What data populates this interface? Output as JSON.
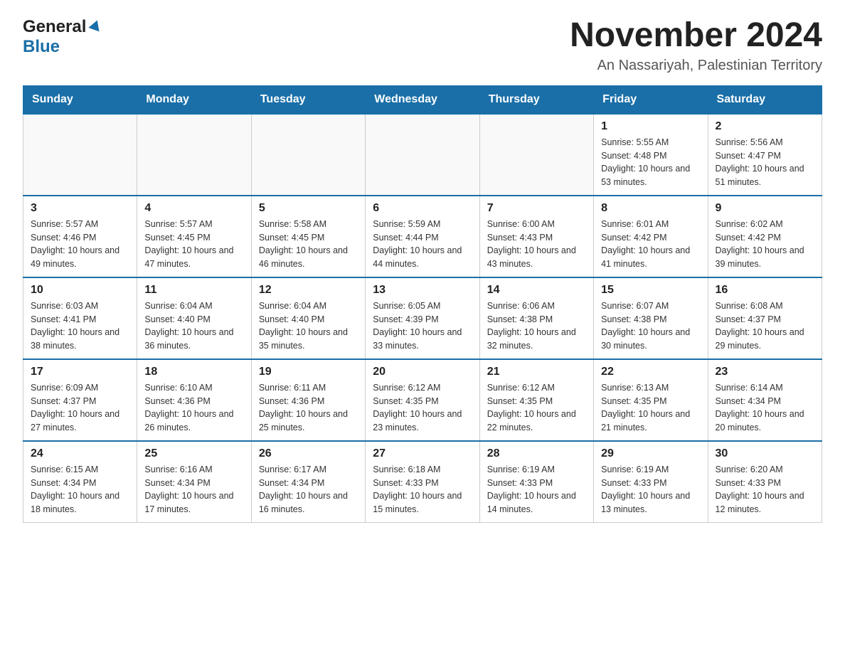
{
  "header": {
    "logo_general": "General",
    "logo_blue": "Blue",
    "month_title": "November 2024",
    "location": "An Nassariyah, Palestinian Territory"
  },
  "days_of_week": [
    "Sunday",
    "Monday",
    "Tuesday",
    "Wednesday",
    "Thursday",
    "Friday",
    "Saturday"
  ],
  "weeks": [
    {
      "days": [
        {
          "num": "",
          "info": ""
        },
        {
          "num": "",
          "info": ""
        },
        {
          "num": "",
          "info": ""
        },
        {
          "num": "",
          "info": ""
        },
        {
          "num": "",
          "info": ""
        },
        {
          "num": "1",
          "info": "Sunrise: 5:55 AM\nSunset: 4:48 PM\nDaylight: 10 hours and 53 minutes."
        },
        {
          "num": "2",
          "info": "Sunrise: 5:56 AM\nSunset: 4:47 PM\nDaylight: 10 hours and 51 minutes."
        }
      ]
    },
    {
      "days": [
        {
          "num": "3",
          "info": "Sunrise: 5:57 AM\nSunset: 4:46 PM\nDaylight: 10 hours and 49 minutes."
        },
        {
          "num": "4",
          "info": "Sunrise: 5:57 AM\nSunset: 4:45 PM\nDaylight: 10 hours and 47 minutes."
        },
        {
          "num": "5",
          "info": "Sunrise: 5:58 AM\nSunset: 4:45 PM\nDaylight: 10 hours and 46 minutes."
        },
        {
          "num": "6",
          "info": "Sunrise: 5:59 AM\nSunset: 4:44 PM\nDaylight: 10 hours and 44 minutes."
        },
        {
          "num": "7",
          "info": "Sunrise: 6:00 AM\nSunset: 4:43 PM\nDaylight: 10 hours and 43 minutes."
        },
        {
          "num": "8",
          "info": "Sunrise: 6:01 AM\nSunset: 4:42 PM\nDaylight: 10 hours and 41 minutes."
        },
        {
          "num": "9",
          "info": "Sunrise: 6:02 AM\nSunset: 4:42 PM\nDaylight: 10 hours and 39 minutes."
        }
      ]
    },
    {
      "days": [
        {
          "num": "10",
          "info": "Sunrise: 6:03 AM\nSunset: 4:41 PM\nDaylight: 10 hours and 38 minutes."
        },
        {
          "num": "11",
          "info": "Sunrise: 6:04 AM\nSunset: 4:40 PM\nDaylight: 10 hours and 36 minutes."
        },
        {
          "num": "12",
          "info": "Sunrise: 6:04 AM\nSunset: 4:40 PM\nDaylight: 10 hours and 35 minutes."
        },
        {
          "num": "13",
          "info": "Sunrise: 6:05 AM\nSunset: 4:39 PM\nDaylight: 10 hours and 33 minutes."
        },
        {
          "num": "14",
          "info": "Sunrise: 6:06 AM\nSunset: 4:38 PM\nDaylight: 10 hours and 32 minutes."
        },
        {
          "num": "15",
          "info": "Sunrise: 6:07 AM\nSunset: 4:38 PM\nDaylight: 10 hours and 30 minutes."
        },
        {
          "num": "16",
          "info": "Sunrise: 6:08 AM\nSunset: 4:37 PM\nDaylight: 10 hours and 29 minutes."
        }
      ]
    },
    {
      "days": [
        {
          "num": "17",
          "info": "Sunrise: 6:09 AM\nSunset: 4:37 PM\nDaylight: 10 hours and 27 minutes."
        },
        {
          "num": "18",
          "info": "Sunrise: 6:10 AM\nSunset: 4:36 PM\nDaylight: 10 hours and 26 minutes."
        },
        {
          "num": "19",
          "info": "Sunrise: 6:11 AM\nSunset: 4:36 PM\nDaylight: 10 hours and 25 minutes."
        },
        {
          "num": "20",
          "info": "Sunrise: 6:12 AM\nSunset: 4:35 PM\nDaylight: 10 hours and 23 minutes."
        },
        {
          "num": "21",
          "info": "Sunrise: 6:12 AM\nSunset: 4:35 PM\nDaylight: 10 hours and 22 minutes."
        },
        {
          "num": "22",
          "info": "Sunrise: 6:13 AM\nSunset: 4:35 PM\nDaylight: 10 hours and 21 minutes."
        },
        {
          "num": "23",
          "info": "Sunrise: 6:14 AM\nSunset: 4:34 PM\nDaylight: 10 hours and 20 minutes."
        }
      ]
    },
    {
      "days": [
        {
          "num": "24",
          "info": "Sunrise: 6:15 AM\nSunset: 4:34 PM\nDaylight: 10 hours and 18 minutes."
        },
        {
          "num": "25",
          "info": "Sunrise: 6:16 AM\nSunset: 4:34 PM\nDaylight: 10 hours and 17 minutes."
        },
        {
          "num": "26",
          "info": "Sunrise: 6:17 AM\nSunset: 4:34 PM\nDaylight: 10 hours and 16 minutes."
        },
        {
          "num": "27",
          "info": "Sunrise: 6:18 AM\nSunset: 4:33 PM\nDaylight: 10 hours and 15 minutes."
        },
        {
          "num": "28",
          "info": "Sunrise: 6:19 AM\nSunset: 4:33 PM\nDaylight: 10 hours and 14 minutes."
        },
        {
          "num": "29",
          "info": "Sunrise: 6:19 AM\nSunset: 4:33 PM\nDaylight: 10 hours and 13 minutes."
        },
        {
          "num": "30",
          "info": "Sunrise: 6:20 AM\nSunset: 4:33 PM\nDaylight: 10 hours and 12 minutes."
        }
      ]
    }
  ]
}
